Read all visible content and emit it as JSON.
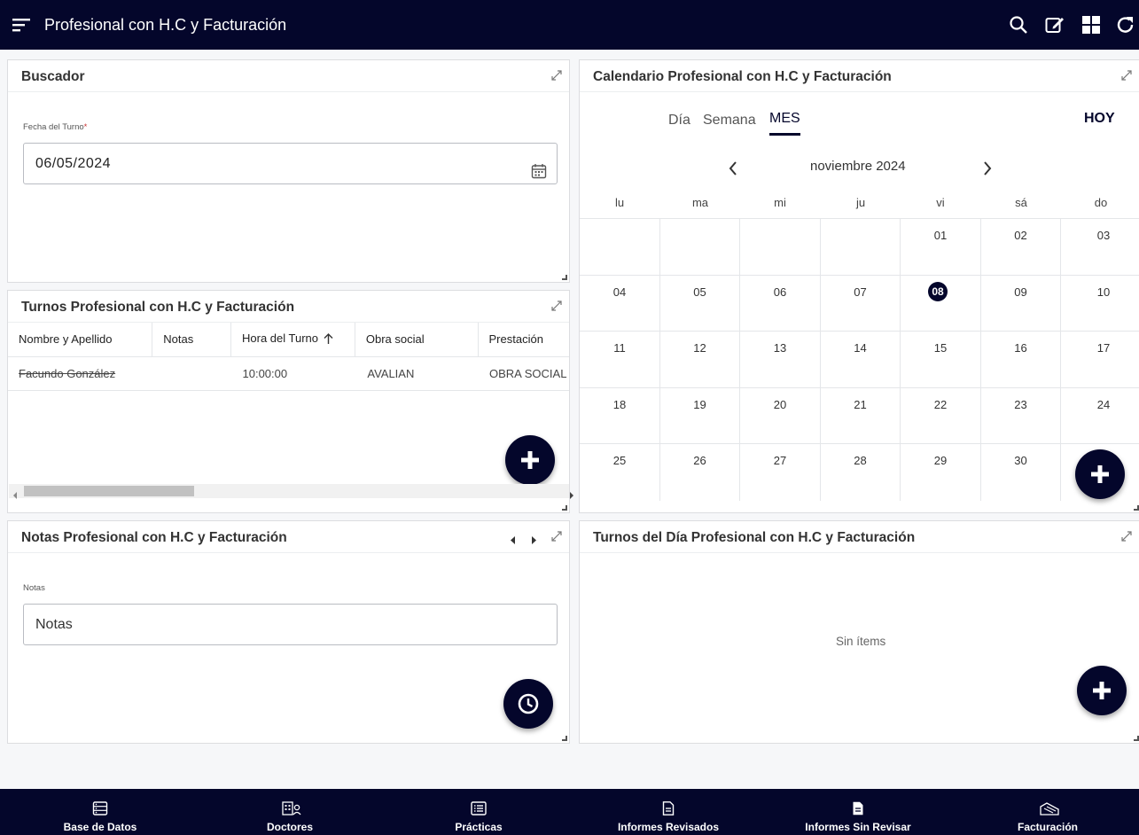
{
  "app": {
    "title": "Profesional con H.C y Facturación"
  },
  "colors": {
    "primary": "#04062b",
    "background": "#f6f7f9"
  },
  "toolbar": {
    "icons": [
      "search-icon",
      "edit-icon",
      "grid-icon",
      "refresh-icon"
    ]
  },
  "buscador": {
    "title": "Buscador",
    "date_label": "Fecha del Turno",
    "required_mark": "*",
    "date_value": "06/05/2024"
  },
  "turnos": {
    "title": "Turnos Profesional con H.C y Facturación",
    "columns": [
      "Nombre y Apellido",
      "Notas",
      "Hora del Turno",
      "Obra social",
      "Prestación"
    ],
    "rows": [
      {
        "nombre": "Facundo González",
        "notas": "",
        "hora": "10:00:00",
        "obra_social": "AVALIAN",
        "prestacion": "OBRA SOCIAL"
      }
    ]
  },
  "calendario": {
    "title": "Calendario Profesional con H.C y Facturación",
    "tabs": [
      "Día",
      "Semana",
      "MES"
    ],
    "active_tab": "MES",
    "today_label": "HOY",
    "month_label": "noviembre 2024",
    "weekdays": [
      "lu",
      "ma",
      "mi",
      "ju",
      "vi",
      "sá",
      "do"
    ],
    "weeks": [
      [
        "",
        "",
        "",
        "",
        "01",
        "02",
        "03"
      ],
      [
        "04",
        "05",
        "06",
        "07",
        "08",
        "09",
        "10"
      ],
      [
        "11",
        "12",
        "13",
        "14",
        "15",
        "16",
        "17"
      ],
      [
        "18",
        "19",
        "20",
        "21",
        "22",
        "23",
        "24"
      ],
      [
        "25",
        "26",
        "27",
        "28",
        "29",
        "30",
        ""
      ]
    ],
    "selected_day": "08"
  },
  "notas": {
    "title": "Notas Profesional con H.C y Facturación",
    "label": "Notas",
    "placeholder": "Notas"
  },
  "turnos_dia": {
    "title": "Turnos del Día Profesional con H.C y Facturación",
    "empty_text": "Sin ítems"
  },
  "bottom_nav": [
    {
      "label": "Base de Datos",
      "icon": "database-icon"
    },
    {
      "label": "Doctores",
      "icon": "doctors-icon"
    },
    {
      "label": "Prácticas",
      "icon": "list-icon"
    },
    {
      "label": "Informes Revisados",
      "icon": "document-icon"
    },
    {
      "label": "Informes Sin Revisar",
      "icon": "document-filled-icon"
    },
    {
      "label": "Facturación",
      "icon": "billing-icon"
    }
  ]
}
